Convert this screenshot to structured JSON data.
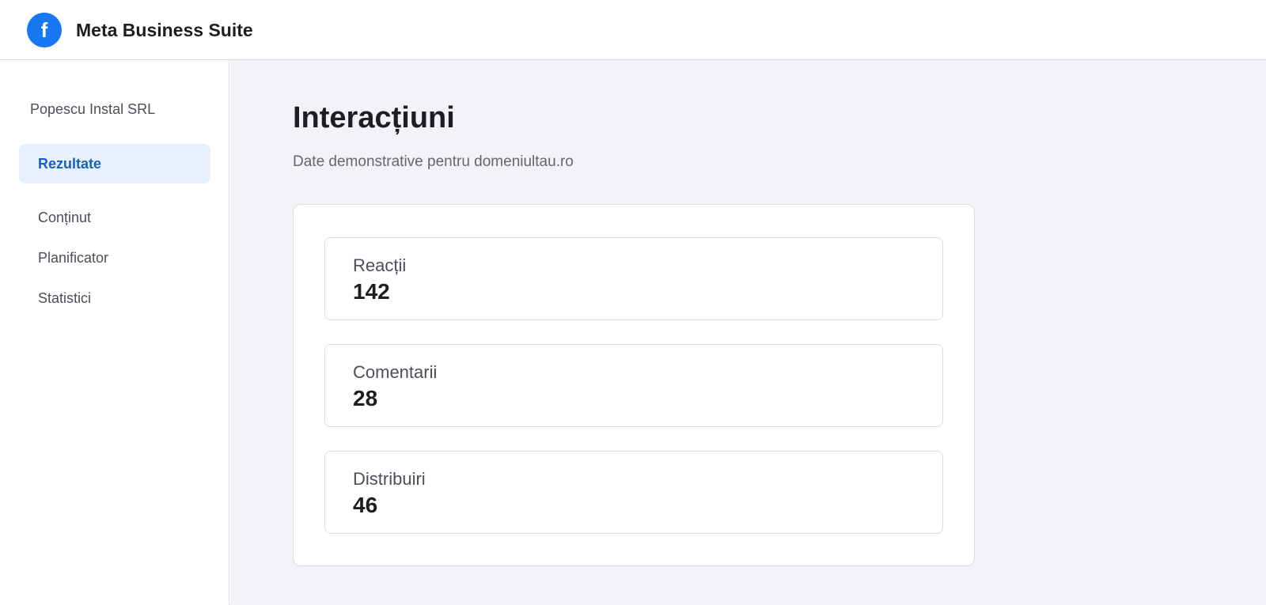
{
  "header": {
    "logo_icon": "facebook-logo-icon",
    "brand_color": "#1877f2",
    "title": "Meta Business Suite"
  },
  "sidebar": {
    "account_name": "Popescu Instal SRL",
    "items": [
      {
        "label": "Rezultate",
        "active": true
      },
      {
        "label": "Conținut",
        "active": false
      },
      {
        "label": "Planificator",
        "active": false
      },
      {
        "label": "Statistici",
        "active": false
      }
    ]
  },
  "main": {
    "title": "Interacțiuni",
    "subtitle": "Date demonstrative pentru domeniultau.ro",
    "metrics": [
      {
        "label": "Reacții",
        "value": "142"
      },
      {
        "label": "Comentarii",
        "value": "28"
      },
      {
        "label": "Distribuiri",
        "value": "46"
      }
    ]
  }
}
